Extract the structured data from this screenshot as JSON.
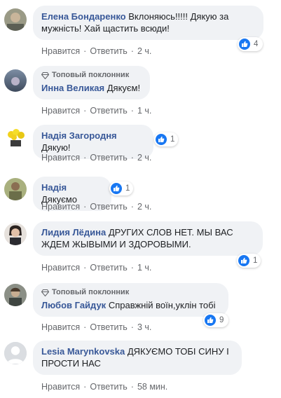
{
  "badge_label": "Топовый поклонник",
  "actions": {
    "like": "Нравится",
    "reply": "Ответить",
    "sep": "·"
  },
  "comments": [
    {
      "author": "Елена Бондаренко",
      "text": "Вклоняюсь!!!!! Дякую за мужність! Хай щастить всюди!",
      "time": "2 ч.",
      "reactions": "4"
    },
    {
      "author": "Инна Великая",
      "text": "Дякуєм!",
      "time": "1 ч.",
      "badge": true
    },
    {
      "author": "Надія Загородня",
      "text": "Дякую!",
      "time": "2 ч.",
      "reactions": "1"
    },
    {
      "author": "Надія",
      "text": "Дякуємо",
      "time": "2 ч.",
      "reactions": "1"
    },
    {
      "author": "Лидия Лёдина",
      "text": "ДРУГИХ СЛОВ НЕТ. МЫ ВАС ЖДЕМ ЖЫВЫМИ И ЗДОРОВЫМИ.",
      "time": "1 ч.",
      "reactions": "1"
    },
    {
      "author": "Любов Гайдук",
      "text": "Справжній воїн,уклін тобі",
      "time": "3 ч.",
      "reactions": "9",
      "badge": true
    },
    {
      "author": "Lesia Marynkovska",
      "text": "ДЯКУЄМО ТОБІ СИНУ І ПРОСТИ НАС",
      "time": "58 мин."
    }
  ],
  "colors": {
    "author": "#385898",
    "bubble": "#f0f2f5",
    "meta": "#65676b",
    "like": "#1877f2"
  }
}
